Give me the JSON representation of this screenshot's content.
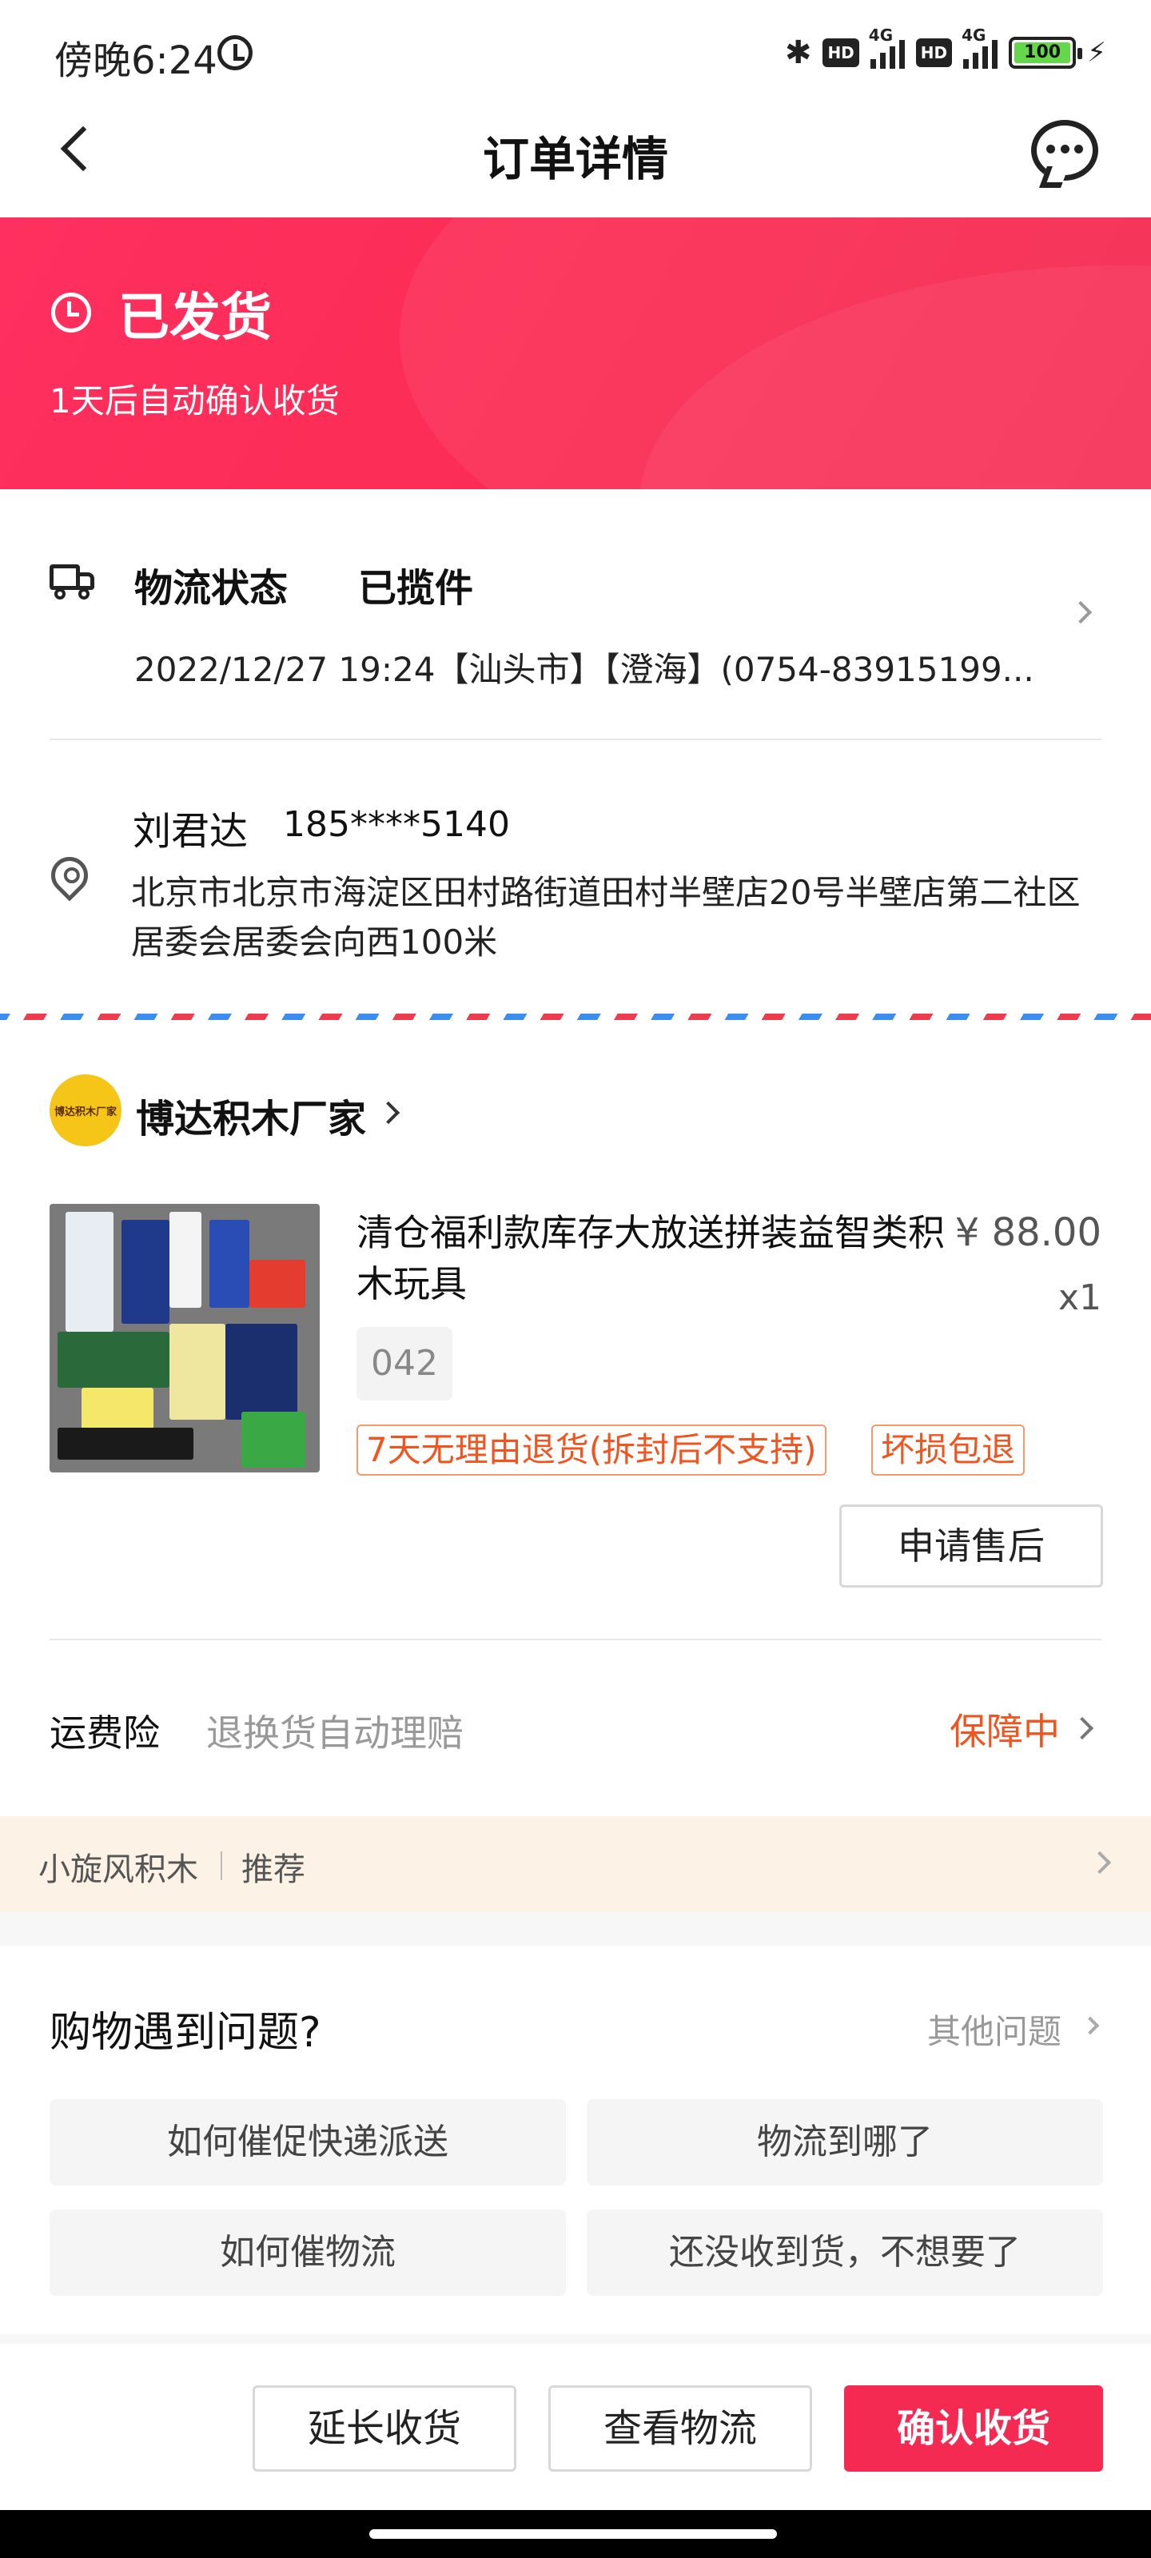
{
  "status_bar": {
    "time": "傍晚6:24",
    "icons": [
      "alarm-icon",
      "bluetooth-icon",
      "hd-icon",
      "signal-4g-icon",
      "hd-icon",
      "signal-4g-icon",
      "battery-icon",
      "charging-icon"
    ],
    "hd_label": "HD",
    "network_label": "4G",
    "battery": "100"
  },
  "nav": {
    "title": "订单详情",
    "back_icon": "chevron-left-icon",
    "chat_icon": "chat-bubble-icon"
  },
  "hero": {
    "status": "已发货",
    "subtitle": "1天后自动确认收货",
    "icon": "clock-icon",
    "color": "#fb2d55"
  },
  "logistics": {
    "label": "物流状态",
    "status": "已揽件",
    "detail": "2022/12/27 19:24【汕头市】【澄海】(0754-83915199...",
    "icon": "truck-icon"
  },
  "address": {
    "name": "刘君达",
    "phone": "185****5140",
    "text": "北京市北京市海淀区田村路街道田村半壁店20号半壁店第二社区居委会居委会向西100米",
    "icon": "location-pin-icon"
  },
  "shop": {
    "name": "博达积木厂家",
    "avatar_text": "博达积木厂家"
  },
  "product": {
    "title": "清仓福利款库存大放送拼装益智类积木玩具",
    "price": "¥ 88.00",
    "quantity": "x1",
    "sku": "042",
    "tags": [
      "7天无理由退货(拆封后不支持)",
      "坏损包退"
    ],
    "after_sale_button": "申请售后"
  },
  "insurance": {
    "label": "运费险",
    "description": "退换货自动理赔",
    "status": "保障中",
    "status_color": "#f0541f"
  },
  "recommend": {
    "shop": "小旋风积木",
    "label": "推荐"
  },
  "help": {
    "title": "购物遇到问题?",
    "other_link": "其他问题",
    "questions": [
      "如何催促快递派送",
      "物流到哪了",
      "如何催物流",
      "还没收到货，不想要了"
    ]
  },
  "bottom_actions": {
    "extend": "延长收货",
    "view_logistics": "查看物流",
    "confirm": "确认收货",
    "confirm_color": "#f52a52"
  }
}
